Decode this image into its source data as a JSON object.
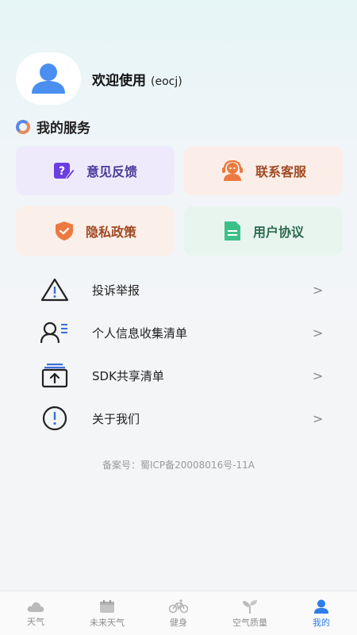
{
  "profile": {
    "welcome": "欢迎使用",
    "username": "(eocj)"
  },
  "services": {
    "title": "我的服务",
    "cards": [
      {
        "label": "意见反馈",
        "icon": "feedback-edit-icon",
        "color": "#6a3ee0"
      },
      {
        "label": "联系客服",
        "icon": "customer-service-icon",
        "color": "#ec7a40"
      },
      {
        "label": "隐私政策",
        "icon": "shield-check-icon",
        "color": "#ec7a40"
      },
      {
        "label": "用户协议",
        "icon": "document-icon",
        "color": "#3cc08a"
      }
    ]
  },
  "list": [
    {
      "label": "投诉举报",
      "icon": "warning-triangle-icon"
    },
    {
      "label": "个人信息收集清单",
      "icon": "person-list-icon"
    },
    {
      "label": "SDK共享清单",
      "icon": "share-stack-icon"
    },
    {
      "label": "关于我们",
      "icon": "info-exclamation-icon"
    }
  ],
  "footer": {
    "record": "备案号：蜀ICP备20008016号-11A"
  },
  "tabs": [
    {
      "label": "天气",
      "icon": "cloud-icon"
    },
    {
      "label": "未来天气",
      "icon": "calendar-icon"
    },
    {
      "label": "健身",
      "icon": "bicycle-icon"
    },
    {
      "label": "空气质量",
      "icon": "sprout-icon"
    },
    {
      "label": "我的",
      "icon": "user-icon",
      "active": true
    }
  ],
  "colors": {
    "accent": "#2f7de6",
    "avatar": "#4a8ff0"
  }
}
